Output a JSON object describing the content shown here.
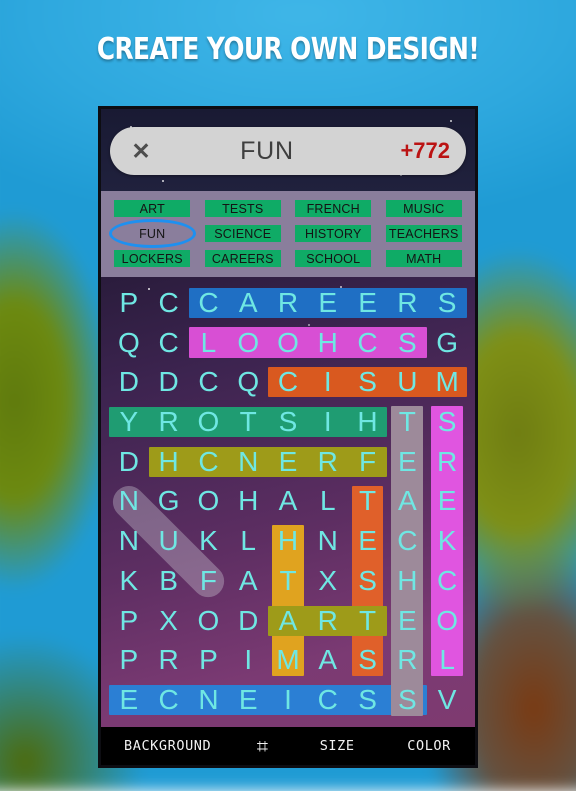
{
  "banner": {
    "headline": "CREATE YOUR OWN DESIGN!"
  },
  "header": {
    "close_icon": "close-icon",
    "close_glyph": "✕",
    "title": "FUN",
    "score": "+772",
    "score_color": "#bb1313",
    "pill_color": "#d3d3d3"
  },
  "categories": {
    "selected": "FUN",
    "highlight_color": "#0fab66",
    "selection_ring_color": "#1e90f0",
    "rows": [
      [
        "ART",
        "TESTS",
        "FRENCH",
        "MUSIC"
      ],
      [
        "FUN",
        "SCIENCE",
        "HISTORY",
        "TEACHERS"
      ],
      [
        "LOCKERS",
        "CAREERS",
        "SCHOOL",
        "MATH"
      ]
    ]
  },
  "board": {
    "columns": 9,
    "rows": 11,
    "letter_color": "#6fe7e3",
    "grid": [
      [
        "P",
        "C",
        "C",
        "A",
        "R",
        "E",
        "E",
        "R",
        "S"
      ],
      [
        "Q",
        "C",
        "L",
        "O",
        "O",
        "H",
        "C",
        "S",
        "G"
      ],
      [
        "D",
        "D",
        "C",
        "Q",
        "C",
        "I",
        "S",
        "U",
        "M"
      ],
      [
        "Y",
        "R",
        "O",
        "T",
        "S",
        "I",
        "H",
        "T",
        "S"
      ],
      [
        "D",
        "H",
        "C",
        "N",
        "E",
        "R",
        "F",
        "E",
        "R"
      ],
      [
        "N",
        "G",
        "O",
        "H",
        "A",
        "L",
        "T",
        "A",
        "E"
      ],
      [
        "N",
        "U",
        "K",
        "L",
        "H",
        "N",
        "E",
        "C",
        "K"
      ],
      [
        "K",
        "B",
        "F",
        "A",
        "T",
        "X",
        "S",
        "H",
        "C"
      ],
      [
        "P",
        "X",
        "O",
        "D",
        "A",
        "R",
        "T",
        "E",
        "O"
      ],
      [
        "P",
        "R",
        "P",
        "I",
        "M",
        "A",
        "S",
        "R",
        "L"
      ],
      [
        "E",
        "C",
        "N",
        "E",
        "I",
        "C",
        "S",
        "S",
        "V"
      ]
    ],
    "found_words": [
      {
        "word": "CAREERS",
        "color": "#1f6fc4",
        "row": 0,
        "col_start": 2,
        "col_end": 8,
        "orientation": "horizontal"
      },
      {
        "word": "SCHOOL",
        "color": "#d84fd4",
        "row": 1,
        "col_start": 2,
        "col_end": 7,
        "orientation": "horizontal"
      },
      {
        "word": "MUSIC",
        "color": "#d9591f",
        "row": 2,
        "col_start": 4,
        "col_end": 8,
        "orientation": "horizontal"
      },
      {
        "word": "HISTORY",
        "color": "#1f9c72",
        "row": 3,
        "col_start": 0,
        "col_end": 6,
        "orientation": "horizontal"
      },
      {
        "word": "FRENCH",
        "color": "#9e9b19",
        "row": 4,
        "col_start": 1,
        "col_end": 6,
        "orientation": "horizontal"
      },
      {
        "word": "SCIENCE",
        "color": "#2b7fd4",
        "row": 10,
        "col_start": 0,
        "col_end": 7,
        "orientation": "horizontal"
      },
      {
        "word": "TEACHERS",
        "color": "#9d8a9a",
        "col": 7,
        "row_start": 3,
        "row_end": 10,
        "orientation": "vertical"
      },
      {
        "word": "LOCKERS",
        "color": "#e055e0",
        "col": 8,
        "row_start": 3,
        "row_end": 9,
        "orientation": "vertical"
      },
      {
        "word": "TESTS",
        "color": "#e0602a",
        "col": 6,
        "row_start": 5,
        "row_end": 9,
        "orientation": "vertical"
      },
      {
        "word": "MATH",
        "color": "#e0a31f",
        "col": 4,
        "row_start": 6,
        "row_end": 9,
        "orientation": "vertical"
      },
      {
        "word": "ART",
        "color": "#9e9b19",
        "row": 8,
        "col_start": 4,
        "col_end": 6,
        "orientation": "horizontal"
      }
    ],
    "drag_selection": {
      "color": "rgba(214,214,224,0.34)",
      "from_row": 5,
      "from_col": 0,
      "to_row": 7,
      "to_col": 2
    }
  },
  "toolbar": {
    "background_label": "BACKGROUND",
    "grid_icon": "grid-icon",
    "grid_glyph": "⌗",
    "size_label": "SIZE",
    "color_label": "COLOR"
  }
}
